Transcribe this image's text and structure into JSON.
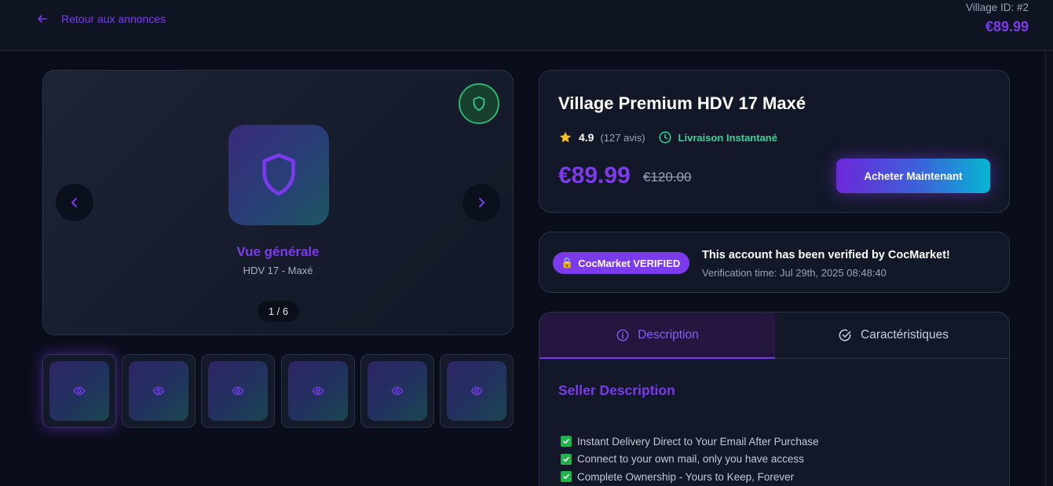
{
  "header": {
    "back_label": "Retour aux annonces",
    "village_id": "Village ID: #2",
    "price": "€89.99"
  },
  "gallery": {
    "slide_title": "Vue générale",
    "slide_subtitle": "HDV 17 - Maxé",
    "counter": "1 / 6",
    "thumbnails": [
      {
        "icon": "eye-icon",
        "active": true
      },
      {
        "icon": "eye-icon",
        "active": false
      },
      {
        "icon": "eye-icon",
        "active": false
      },
      {
        "icon": "eye-icon",
        "active": false
      },
      {
        "icon": "eye-icon",
        "active": false
      },
      {
        "icon": "eye-icon",
        "active": false
      }
    ]
  },
  "product": {
    "title": "Village Premium HDV 17 Maxé",
    "rating": "4.9",
    "reviews": "(127 avis)",
    "delivery": "Livraison Instantané",
    "price": "€89.99",
    "old_price": "€120.00",
    "buy_label": "Acheter Maintenant"
  },
  "verification": {
    "badge_icon": "🔒",
    "badge_label": "CocMarket VERIFIED",
    "title": "This account has been verified by CocMarket!",
    "time": "Verification time: Jul 29th, 2025 08:48:40"
  },
  "tabs": {
    "description_label": "Description",
    "characteristics_label": "Caractéristiques",
    "active": "description"
  },
  "description": {
    "section_title": "Seller Description",
    "features": [
      "Instant Delivery Direct to Your Email After Purchase",
      "Connect to your own mail, only you have access",
      "Complete Ownership - Yours to Keep, Forever"
    ]
  },
  "colors": {
    "accent": "#7c3aed",
    "success": "#34d399",
    "background": "#0a0e1b",
    "card": "#121827"
  }
}
